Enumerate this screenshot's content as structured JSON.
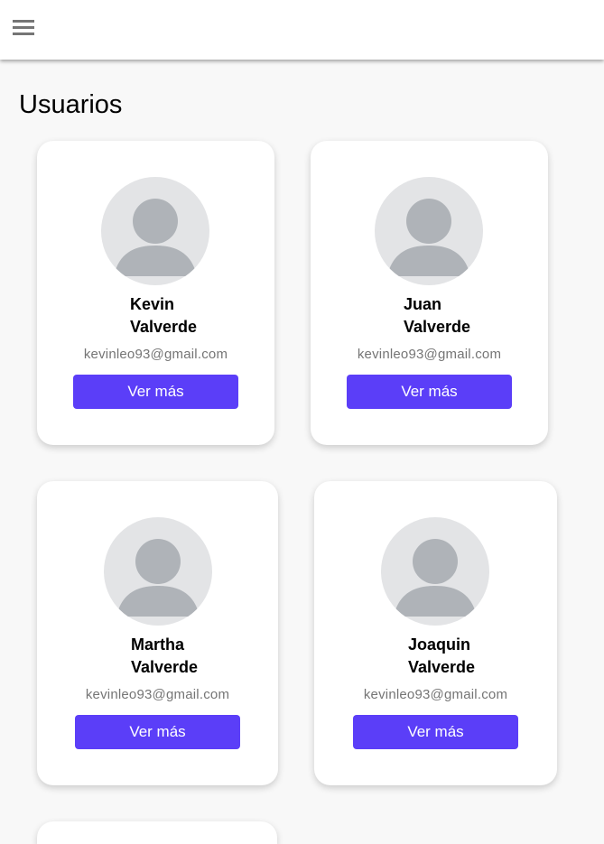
{
  "header": {
    "menu_icon": "hamburger-menu-icon"
  },
  "page": {
    "title": "Usuarios"
  },
  "users": [
    {
      "first": "Kevin",
      "last": "Valverde",
      "email": "kevinleo93@gmail.com",
      "button": "Ver más"
    },
    {
      "first": "Juan",
      "last": "Valverde",
      "email": "kevinleo93@gmail.com",
      "button": "Ver más"
    },
    {
      "first": "Martha",
      "last": "Valverde",
      "email": "kevinleo93@gmail.com",
      "button": "Ver más"
    },
    {
      "first": "Joaquin",
      "last": "Valverde",
      "email": "kevinleo93@gmail.com",
      "button": "Ver más"
    }
  ],
  "colors": {
    "accent": "#5b3ef8",
    "background": "#f8f8f8",
    "avatar_bg": "#e3e4e6",
    "avatar_fg": "#afb3b8"
  }
}
